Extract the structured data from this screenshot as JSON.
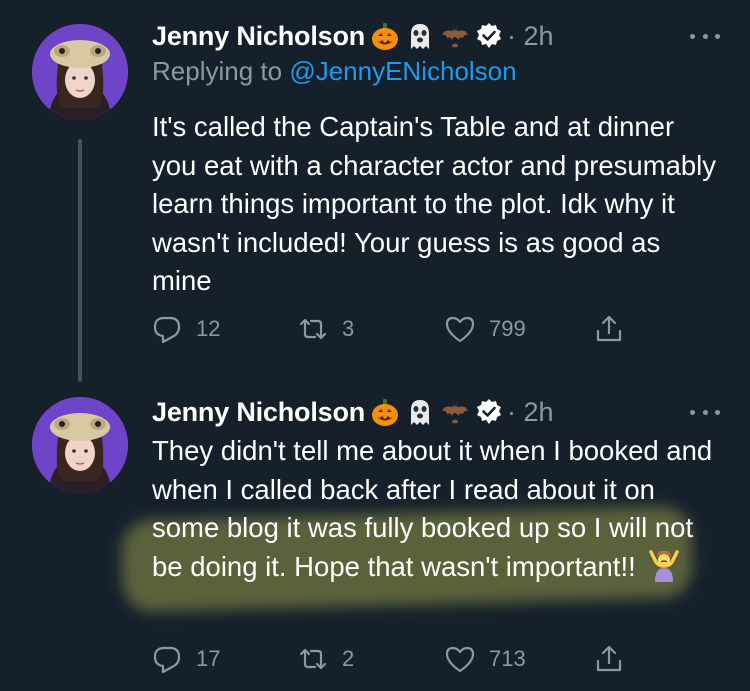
{
  "tweets": [
    {
      "author_name": "Jenny Nicholson",
      "time": "· 2h",
      "replying_label": "Replying to ",
      "replying_handle": "@JennyENicholson",
      "text": "It's called the Captain's Table and at dinner you eat with a character actor and presumably learn things important to the plot. Idk why it wasn't included! Your guess is as good as mine",
      "replies": "12",
      "retweets": "3",
      "likes": "799",
      "icons": [
        "jack-o-lantern-icon",
        "ghost-icon",
        "bat-icon",
        "verified-badge-icon"
      ]
    },
    {
      "author_name": "Jenny Nicholson",
      "time": "· 2h",
      "text": "They didn't tell me about it when I booked and when I called back after I read about it on some blog it was fully booked up so I will not be doing it. Hope that wasn't important!!",
      "trailing_emoji": "person-shrugging-icon",
      "replies": "17",
      "retweets": "2",
      "likes": "713",
      "icons": [
        "jack-o-lantern-icon",
        "ghost-icon",
        "bat-icon",
        "verified-badge-icon"
      ]
    }
  ],
  "colors": {
    "background": "#15202b",
    "text": "#ffffff",
    "muted": "#8b98a5",
    "link": "#1d9bf0",
    "highlight": "#dcdc5a"
  }
}
